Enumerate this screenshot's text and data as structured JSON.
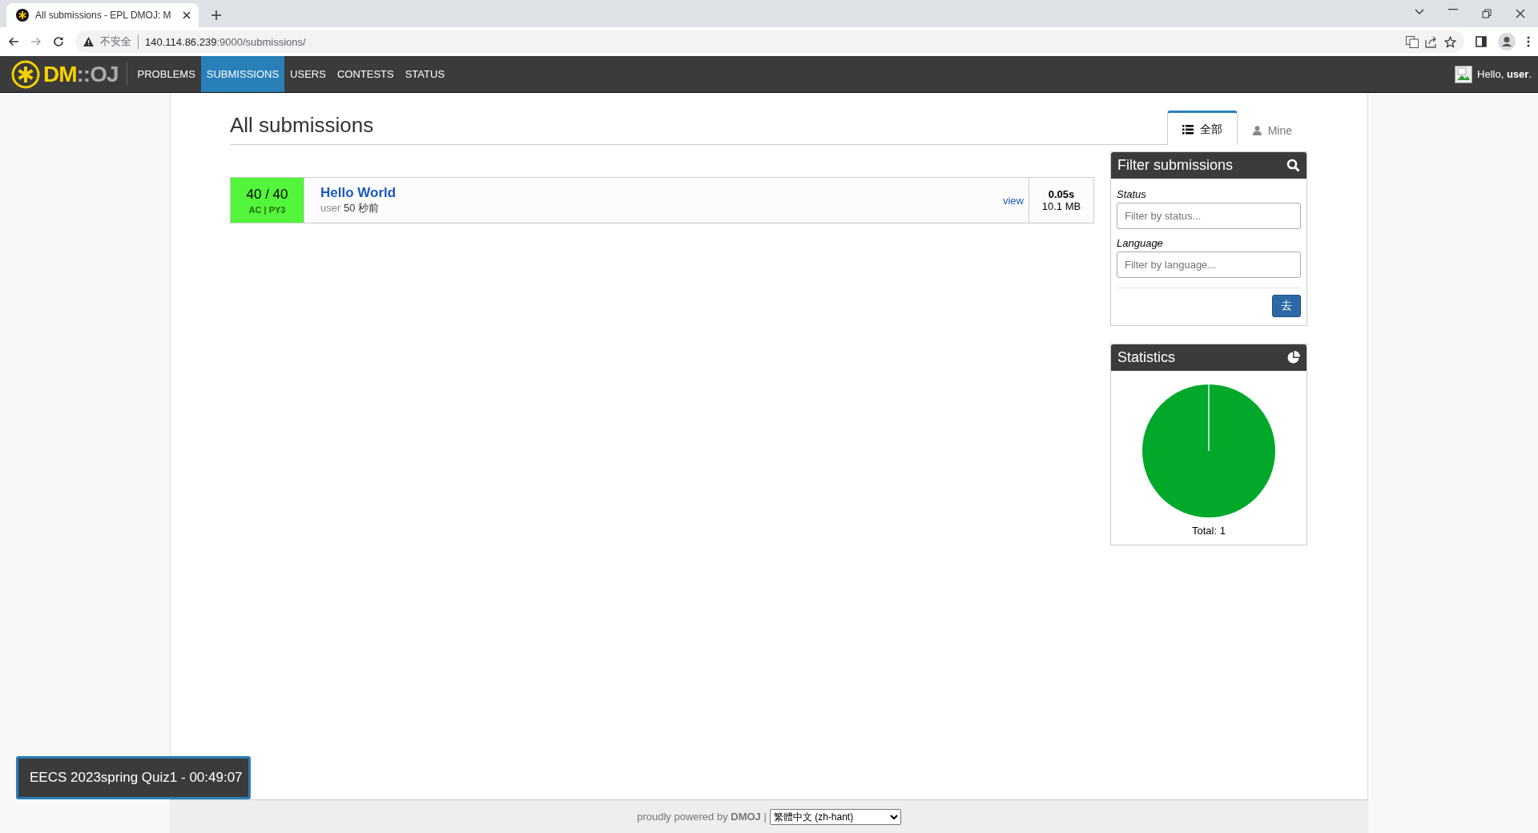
{
  "browser": {
    "tab_title": "All submissions - EPL DMOJ: M",
    "security_label": "不安全",
    "url_host": "140.114.86.239",
    "url_rest": ":9000/submissions/"
  },
  "navbar": {
    "logo_main": "DM",
    "logo_sep": "::",
    "logo_end": "OJ",
    "items": [
      {
        "label": "PROBLEMS",
        "selected": false
      },
      {
        "label": "SUBMISSIONS",
        "selected": true
      },
      {
        "label": "USERS",
        "selected": false
      },
      {
        "label": "CONTESTS",
        "selected": false
      },
      {
        "label": "STATUS",
        "selected": false
      }
    ],
    "greeting": "Hello, ",
    "username": "user",
    "greeting_end": "."
  },
  "page_title": "All submissions",
  "view_tabs": [
    {
      "label": "全部",
      "kind": "list",
      "selected": true
    },
    {
      "label": "Mine",
      "kind": "user",
      "selected": false
    }
  ],
  "submissions": [
    {
      "score": "40 / 40",
      "result": "AC | PY3",
      "kind": "accepted",
      "problem": "Hello World",
      "user": "user",
      "time_ago": "50 秒前",
      "view": "view",
      "run_time": "0.05s",
      "memory": "10.1 MB"
    }
  ],
  "filter": {
    "title": "Filter submissions",
    "fields": [
      {
        "label": "Status",
        "placeholder": "Filter by status..."
      },
      {
        "label": "Language",
        "placeholder": "Filter by language..."
      }
    ],
    "button": "去"
  },
  "statistics": {
    "title": "Statistics",
    "total": "Total: 1"
  },
  "contest_timer": "EECS 2023spring Quiz1 - 00:49:07",
  "footer": {
    "text": "proudly powered by ",
    "brand": "DMOJ",
    "sep": " |",
    "language": "繁體中文 (zh-hant)"
  }
}
